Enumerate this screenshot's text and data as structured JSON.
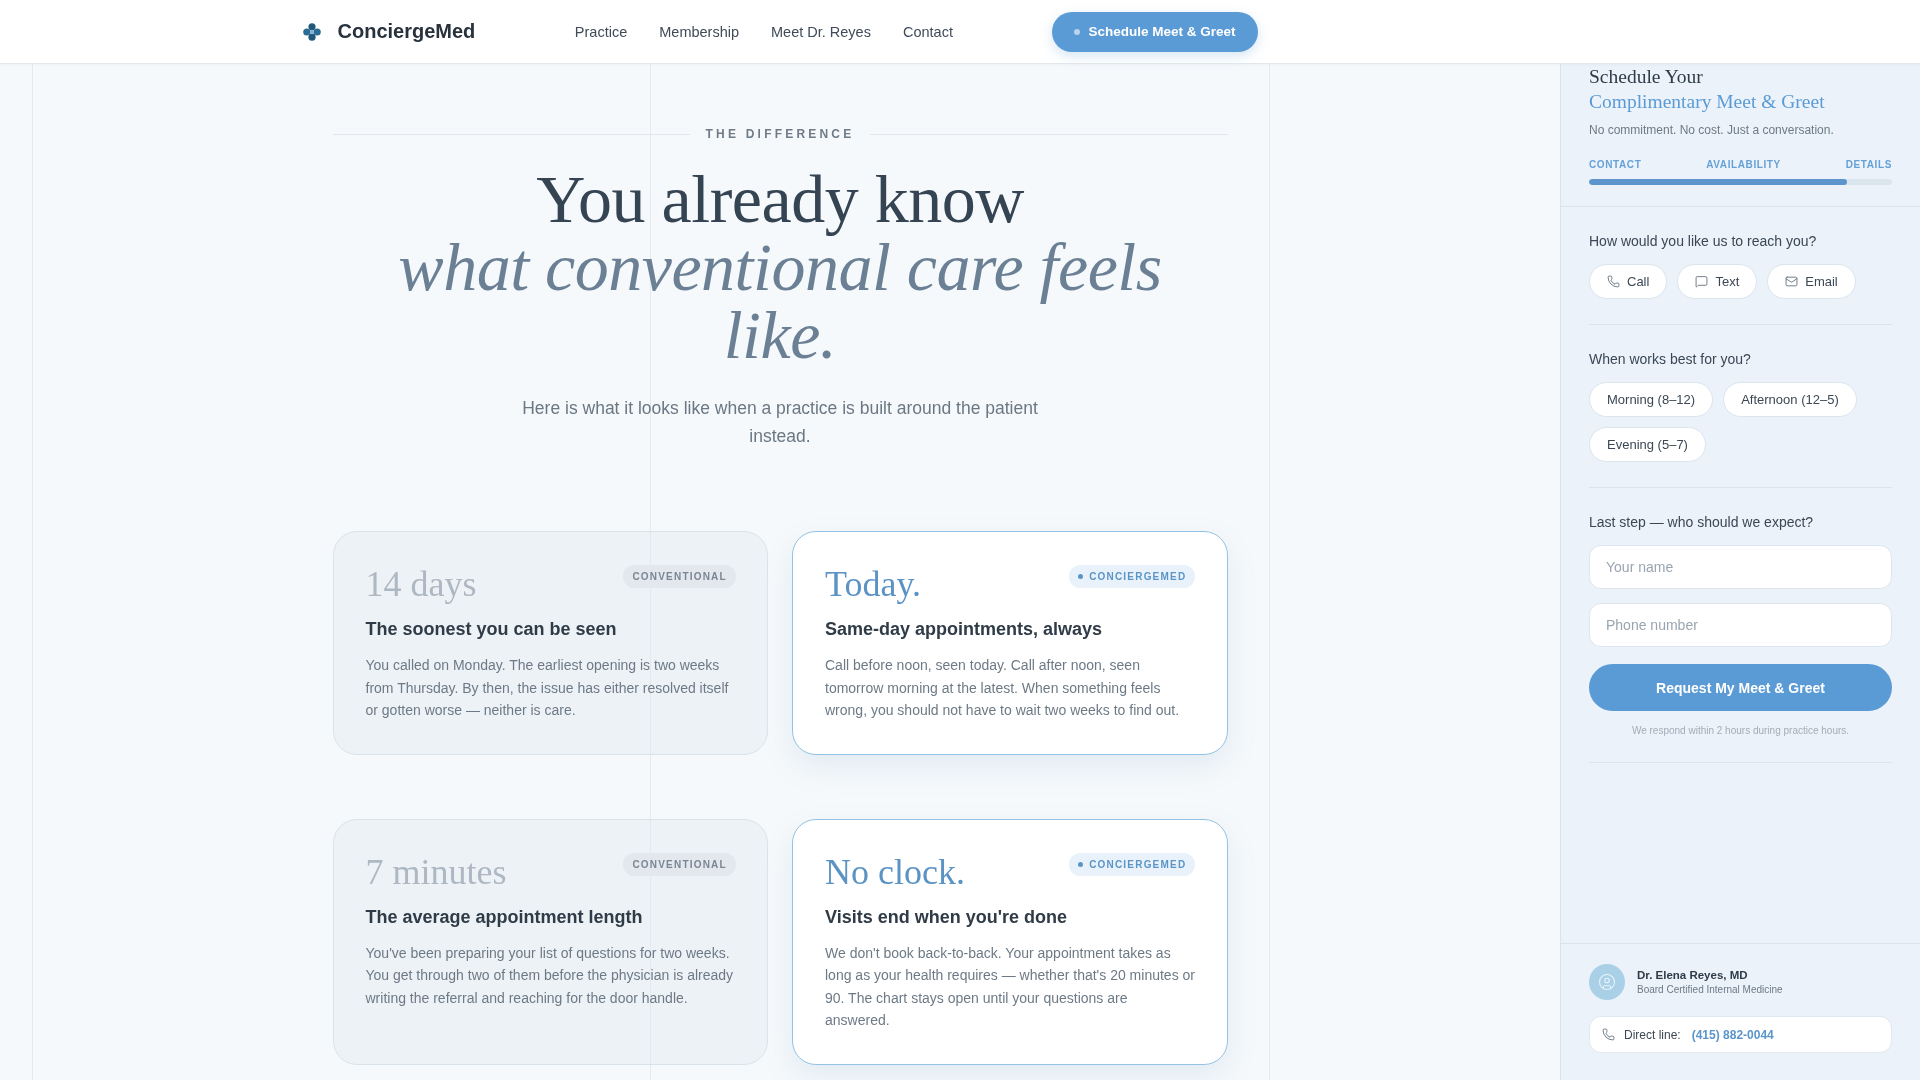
{
  "header": {
    "brand": "ConciergeMed",
    "nav": [
      {
        "label": "Practice"
      },
      {
        "label": "Membership"
      },
      {
        "label": "Meet Dr. Reyes"
      },
      {
        "label": "Contact"
      }
    ],
    "cta": "Schedule Meet & Greet"
  },
  "intro": {
    "eyebrow": "THE DIFFERENCE",
    "headline": "You already know *what conventional care feels like.*",
    "subtitle": "Here is what it looks like when a practice is built around the patient instead."
  },
  "comparisons": [
    {
      "kind": "conventional",
      "figure": "14 days",
      "badge": "CONVENTIONAL",
      "title": "The soonest you can be seen",
      "body": "You called on Monday. The earliest opening is two weeks from Thursday. By then, the issue has either resolved itself or gotten worse — neither is care."
    },
    {
      "kind": "concierge",
      "figure": "Today.",
      "badge": "CONCIERGEMED",
      "title": "Same-day appointments, always",
      "body": "Call before noon, seen today. Call after noon, seen tomorrow morning at the latest. When something feels wrong, you should not have to wait two weeks to find out."
    },
    {
      "kind": "conventional",
      "figure": "7 minutes",
      "badge": "CONVENTIONAL",
      "title": "The average appointment length",
      "body": "You've been preparing your list of questions for two weeks. You get through two of them before the physician is already writing the referral and reaching for the door handle."
    },
    {
      "kind": "concierge",
      "figure": "No clock.",
      "badge": "CONCIERGEMED",
      "title": "Visits end when you're done",
      "body": "We don't book back-to-back. Your appointment takes as long as your health requires — whether that's 20 minutes or 90. The chart stays open until your questions are answered."
    }
  ],
  "booking": {
    "title": "Schedule Your",
    "title_accent": "Complimentary Meet & Greet",
    "subtitle": "No commitment. No cost. Just a conversation.",
    "steps": [
      "CONTACT",
      "AVAILABILITY",
      "DETAILS"
    ],
    "progress": {
      "level": 0.85
    },
    "contact": {
      "question": "How would you like us to reach you?",
      "methods": [
        {
          "kind": "call",
          "label": "Call",
          "selected": false
        },
        {
          "kind": "text",
          "label": "Text",
          "selected": false
        },
        {
          "kind": "email",
          "label": "Email",
          "selected": false
        }
      ]
    },
    "availability": {
      "question": "When works best for you?",
      "slots": [
        {
          "label": "Morning (8–12)",
          "selected": false
        },
        {
          "label": "Afternoon (12–5)",
          "selected": false
        },
        {
          "label": "Evening (5–7)",
          "selected": false
        }
      ]
    },
    "details": {
      "question": "Last step — who should we expect?",
      "fields": [
        {
          "placeholder": "Your name"
        },
        {
          "placeholder": "Phone number"
        }
      ],
      "submit": "Request My Meet & Greet",
      "note": "We respond within 2 hours during practice hours."
    },
    "physician": {
      "name": "Dr. Elena Reyes, MD",
      "credential": "Board Certified Internal Medicine"
    },
    "direct_line": {
      "label": "Direct line:",
      "number": "(415) 882-0044"
    }
  }
}
